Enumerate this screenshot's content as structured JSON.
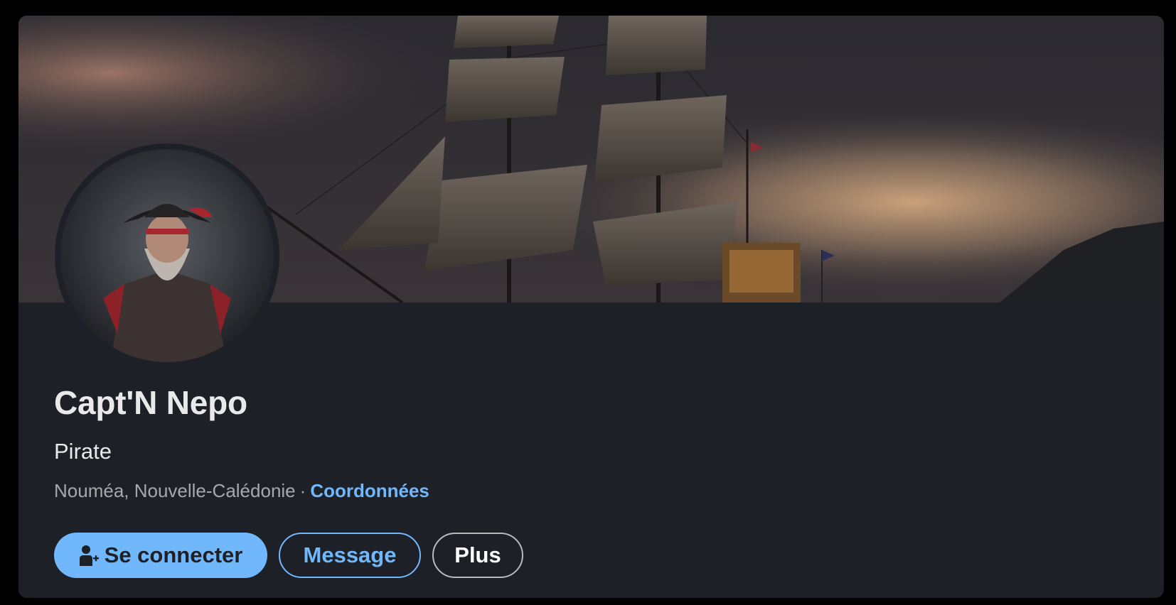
{
  "profile": {
    "name": "Capt'N Nepo",
    "headline": "Pirate",
    "location": "Nouméa, Nouvelle-Calédonie",
    "separator": "·",
    "contact_link": "Coordonnées"
  },
  "actions": {
    "connect_label": "Se connecter",
    "message_label": "Message",
    "more_label": "Plus"
  },
  "icons": {
    "connect": "add-person-icon"
  },
  "colors": {
    "card_bg": "#1d2127",
    "accent": "#71b7fb",
    "text_primary": "#e9e9ea",
    "text_secondary": "#a8a8aa"
  }
}
